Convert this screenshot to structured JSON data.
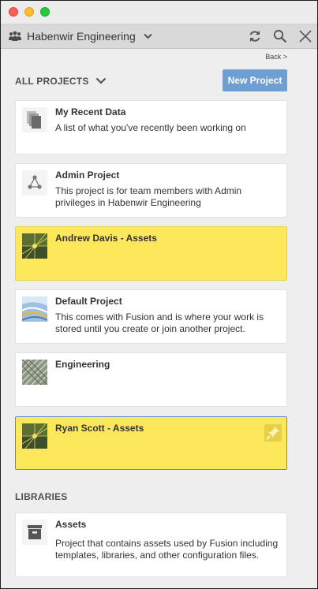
{
  "toolbar": {
    "team_name": "Habenwir Engineering"
  },
  "nav": {
    "back_label": "Back >"
  },
  "projects": {
    "heading": "ALL PROJECTS",
    "new_button": "New Project",
    "items": [
      {
        "title": "My Recent Data",
        "description": "A list of what you've recently been working on",
        "icon": "recent-documents-icon",
        "highlighted": false
      },
      {
        "title": "Admin Project",
        "description": "This project is for team members with Admin privileges in Habenwir Engineering",
        "icon": "admin-nodes-icon",
        "highlighted": false
      },
      {
        "title": "Andrew Davis - Assets",
        "description": "",
        "icon": "assets-thumbnail",
        "highlighted": true
      },
      {
        "title": "Default Project",
        "description": "This comes with Fusion and is where your work is stored until you create or join another project.",
        "icon": "default-project-thumbnail",
        "highlighted": false
      },
      {
        "title": "Engineering",
        "description": "",
        "icon": "engineering-thumbnail",
        "highlighted": false
      },
      {
        "title": "Ryan Scott - Assets",
        "description": "",
        "icon": "assets-thumbnail",
        "highlighted": true,
        "selected": true
      }
    ]
  },
  "libraries": {
    "heading": "LIBRARIES",
    "items": [
      {
        "title": "Assets",
        "description": "Project that contains assets used by Fusion including templates, libraries, and other configuration files.",
        "icon": "archive-box-icon"
      }
    ]
  },
  "colors": {
    "highlight": "#fde75a",
    "button_blue": "#6f9fd2",
    "selected_border": "#5b8ad2"
  }
}
